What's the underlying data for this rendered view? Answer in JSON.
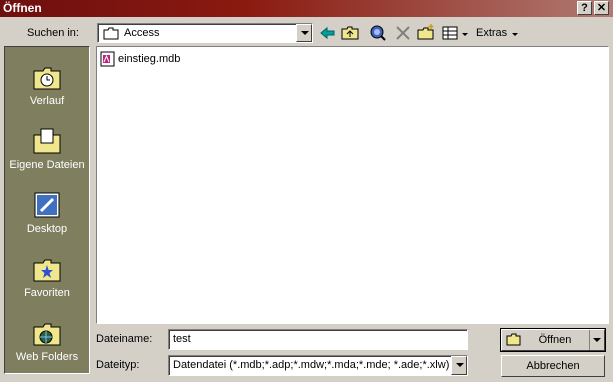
{
  "window": {
    "title": "Öffnen",
    "help_btn": "?",
    "close_btn": "✕"
  },
  "toolbar": {
    "look_in_label": "Suchen in:",
    "look_in_value": "Access",
    "extras_label": "Extras",
    "icons": [
      "back-icon",
      "up-folder-icon",
      "search-web-icon",
      "delete-icon",
      "new-folder-icon",
      "views-icon"
    ]
  },
  "places": [
    {
      "label": "Verlauf",
      "icon": "history-icon"
    },
    {
      "label": "Eigene Dateien",
      "icon": "my-documents-icon"
    },
    {
      "label": "Desktop",
      "icon": "desktop-icon"
    },
    {
      "label": "Favoriten",
      "icon": "favorites-icon"
    },
    {
      "label": "Web Folders",
      "icon": "web-folders-icon"
    }
  ],
  "files": [
    {
      "name": "einstieg.mdb",
      "icon": "access-file-icon"
    }
  ],
  "bottom": {
    "filename_label": "Dateiname:",
    "filename_value": "test",
    "filetype_label": "Dateityp:",
    "filetype_value": "Datendatei (*.mdb;*.adp;*.mdw;*.mda;*.mde; *.ade;*.xlw)",
    "open_label": "Öffnen",
    "cancel_label": "Abbrechen"
  },
  "colors": {
    "titlebar": "#6e0f0f",
    "places_bg": "#7f7f5f",
    "face": "#d4d0c8"
  }
}
